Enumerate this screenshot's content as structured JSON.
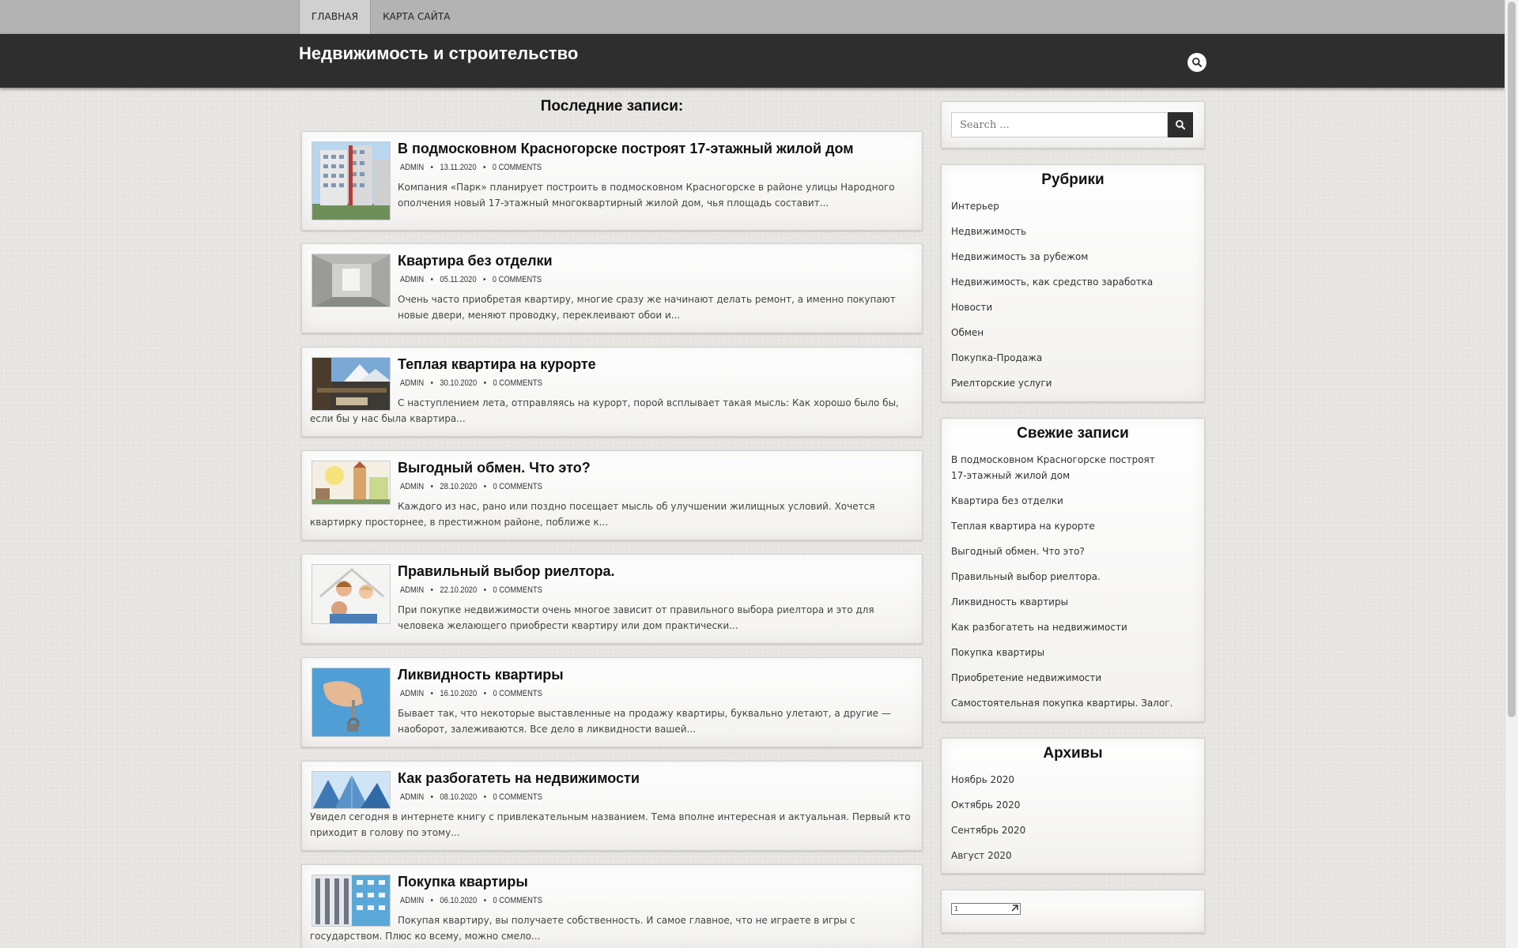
{
  "nav": {
    "items": [
      "ГЛАВНАЯ",
      "КАРТА САЙТА"
    ]
  },
  "header": {
    "site_title": "Недвижимость и строительство",
    "search_icon": "search-icon"
  },
  "main": {
    "section_title": "Последние записи:",
    "posts": [
      {
        "title": "В подмосковном Красногорске построят 17-этажный жилой дом",
        "author": "ADMIN",
        "date": "13.11.2020",
        "comments": "0 COMMENTS",
        "excerpt": "Компания «Парк» планирует построить в подмосковном Красногорске в районе улицы Народного ополчения новый 17-этажный многоквартирный жилой дом, чья площадь составит..."
      },
      {
        "title": "Квартира без отделки",
        "author": "ADMIN",
        "date": "05.11.2020",
        "comments": "0 COMMENTS",
        "excerpt": "Очень часто приобретая квартиру, многие сразу же начинают делать ремонт, а именно покупают новые двери, меняют проводку, переклеивают обои и..."
      },
      {
        "title": "Теплая квартира на курорте",
        "author": "ADMIN",
        "date": "30.10.2020",
        "comments": "0 COMMENTS",
        "excerpt": "С наступлением лета, отправляясь на курорт, порой всплывает такая мысль: Как хорошо было бы, если бы у нас была квартира..."
      },
      {
        "title": "Выгодный обмен. Что это?",
        "author": "ADMIN",
        "date": "28.10.2020",
        "comments": "0 COMMENTS",
        "excerpt": "Каждого из нас, рано или поздно посещает мысль об улучшении жилищных условий. Хочется квартирку просторнее, в престижном районе, поближе к..."
      },
      {
        "title": "Правильный выбор риелтора.",
        "author": "ADMIN",
        "date": "22.10.2020",
        "comments": "0 COMMENTS",
        "excerpt": "При покупке недвижимости очень многое зависит от правильного выбора риелтора и это для человека желающего приобрести квартиру или дом практически..."
      },
      {
        "title": "Ликвидность квартиры",
        "author": "ADMIN",
        "date": "16.10.2020",
        "comments": "0 COMMENTS",
        "excerpt": "Бывает так, что некоторые выставленные на продажу квартиры, буквально улетают, а другие — наоборот, залеживаются. Все дело в ликвидности вашей..."
      },
      {
        "title": "Как разбогатеть на недвижимости",
        "author": "ADMIN",
        "date": "08.10.2020",
        "comments": "0 COMMENTS",
        "excerpt": "Увидел сегодня в интернете книгу с привлекательным названием. Тема вполне интересная и актуальная. Первый кто приходит в голову по этому..."
      },
      {
        "title": "Покупка квартиры",
        "author": "ADMIN",
        "date": "06.10.2020",
        "comments": "0 COMMENTS",
        "excerpt": "Покупая квартиру, вы получаете собственность. И самое главное, что не играете в игры с государством. Плюс ко всему, можно смело..."
      }
    ]
  },
  "sidebar": {
    "search": {
      "placeholder": "Search ..."
    },
    "categories": {
      "title": "Рубрики",
      "items": [
        "Интерьер",
        "Недвижимость",
        "Недвижимость за рубежом",
        "Недвижимость, как средство заработка",
        "Новости",
        "Обмен",
        "Покупка-Продажа",
        "Риелторские услуги"
      ]
    },
    "recent": {
      "title": "Свежие записи",
      "items": [
        "В подмосковном Красногорске построят 17-этажный жилой дом",
        "Квартира без отделки",
        "Теплая квартира на курорте",
        "Выгодный обмен. Что это?",
        "Правильный выбор риелтора.",
        "Ликвидность квартиры",
        "Как разбогатеть на недвижимости",
        "Покупка квартиры",
        "Приобретение недвижимости",
        "Самостоятельная покупка квартиры. Залог."
      ]
    },
    "archives": {
      "title": "Архивы",
      "items": [
        "Ноябрь 2020",
        "Октябрь 2020",
        "Сентябрь 2020",
        "Август 2020"
      ]
    },
    "counter": {
      "text": "1"
    }
  }
}
